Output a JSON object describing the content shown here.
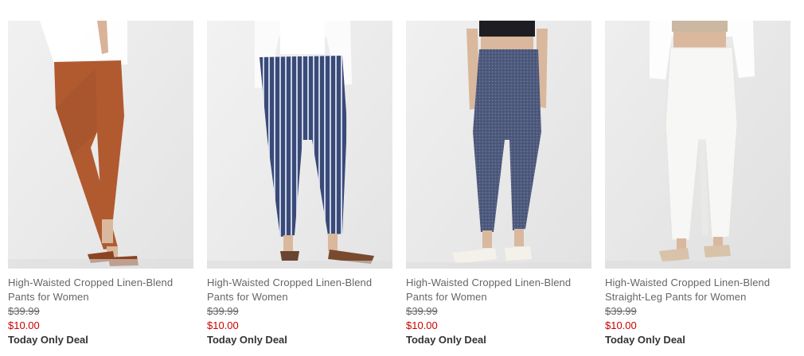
{
  "colors": {
    "sale": "#cc0000",
    "text": "#666666",
    "deal": "#333333",
    "photo_bg": "#ececec"
  },
  "products": [
    {
      "title_line1": "High-Waisted Cropped Linen-Blend",
      "title_line2": "Pants for Women",
      "original_price": "$39.99",
      "sale_price": "$10.00",
      "badge": "Today Only Deal",
      "image": "rust-linen-pants-photo",
      "pant_color": "#b15a30",
      "pattern": "solid"
    },
    {
      "title_line1": "High-Waisted Cropped Linen-Blend",
      "title_line2": "Pants for Women",
      "original_price": "$39.99",
      "sale_price": "$10.00",
      "badge": "Today Only Deal",
      "image": "navy-striped-linen-pants-photo",
      "pant_color": "#3a4a78",
      "pattern": "stripes"
    },
    {
      "title_line1": "High-Waisted Cropped Linen-Blend",
      "title_line2": "Pants for Women",
      "original_price": "$39.99",
      "sale_price": "$10.00",
      "badge": "Today Only Deal",
      "image": "chambray-linen-pants-photo",
      "pant_color": "#4f5b7e",
      "pattern": "heather"
    },
    {
      "title_line1": "High-Waisted Cropped Linen-Blend",
      "title_line2": "Straight-Leg Pants for Women",
      "original_price": "$39.99",
      "sale_price": "$10.00",
      "badge": "Today Only Deal",
      "image": "white-straight-leg-linen-pants-photo",
      "pant_color": "#f6f6f4",
      "pattern": "solid"
    }
  ]
}
